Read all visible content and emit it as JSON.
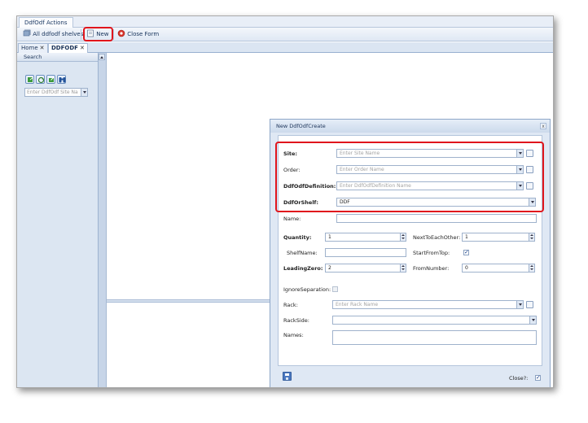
{
  "ribbon": {
    "tab_label": "DdfOdf Actions",
    "buttons": [
      {
        "label": "All ddfodf shelves",
        "icon": "shelves-icon"
      },
      {
        "label": "New",
        "icon": "new-document-icon"
      },
      {
        "label": "Close Form",
        "icon": "close-form-icon"
      }
    ]
  },
  "doc_tabs": [
    {
      "label": "Home",
      "close": "✕"
    },
    {
      "label": "DDFODF",
      "close": "✕"
    }
  ],
  "search_panel": {
    "title": "Search",
    "icons": [
      "export-icon",
      "refresh-icon",
      "import-icon",
      "binoculars-icon"
    ],
    "site_placeholder": "Enter DdfOdf Site Na"
  },
  "dialog": {
    "title": "New DdfOdfCreate",
    "close": "x",
    "fields": {
      "site": {
        "label": "Site:",
        "placeholder": "Enter Site Name"
      },
      "order": {
        "label": "Order:",
        "placeholder": "Enter Order Name"
      },
      "definition": {
        "label": "DdfOdfDefinition:",
        "placeholder": "Enter DdfOdfDefinition Name"
      },
      "shelf": {
        "label": "DdfOrShelf:",
        "value": "DDF"
      },
      "name": {
        "label": "Name:",
        "value": ""
      },
      "quantity": {
        "label": "Quantity:",
        "value": "1"
      },
      "next_to_each_other": {
        "label": "NextToEachOther:",
        "value": "1"
      },
      "shelf_name": {
        "label": "ShelfName:",
        "value": ""
      },
      "start_from_top": {
        "label": "StartFromTop:",
        "checked": true
      },
      "leading_zero": {
        "label": "LeadingZero:",
        "value": "2"
      },
      "from_number": {
        "label": "FromNumber:",
        "value": "0"
      },
      "ignore_separation": {
        "label": "IgnoreSeparation:",
        "checked": false
      },
      "rack": {
        "label": "Rack:",
        "placeholder": "Enter Rack Name"
      },
      "rack_side": {
        "label": "RackSide:",
        "value": ""
      },
      "names": {
        "label": "Names:",
        "value": ""
      }
    },
    "footer": {
      "close_label": "Close?:",
      "close_checked": true
    }
  },
  "colors": {
    "highlight": "#e0151c",
    "accent": "#4b78c0",
    "panel": "#dce6f2"
  }
}
